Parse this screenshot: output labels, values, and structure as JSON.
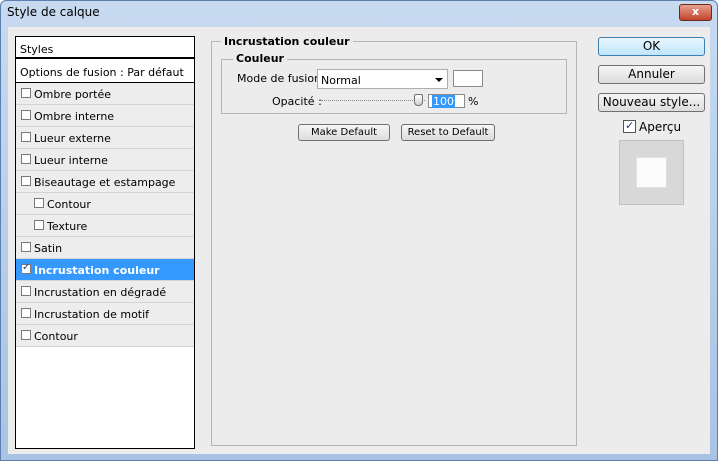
{
  "window": {
    "title": "Style de calque",
    "close_label": "x"
  },
  "styles_list": {
    "header": "Styles",
    "options": "Options de fusion : Par défaut",
    "items": [
      {
        "label": "Ombre portée",
        "checked": false,
        "indent": false,
        "selected": false
      },
      {
        "label": "Ombre interne",
        "checked": false,
        "indent": false,
        "selected": false
      },
      {
        "label": "Lueur externe",
        "checked": false,
        "indent": false,
        "selected": false
      },
      {
        "label": "Lueur interne",
        "checked": false,
        "indent": false,
        "selected": false
      },
      {
        "label": "Biseautage et estampage",
        "checked": false,
        "indent": false,
        "selected": false
      },
      {
        "label": "Contour",
        "checked": false,
        "indent": true,
        "selected": false
      },
      {
        "label": "Texture",
        "checked": false,
        "indent": true,
        "selected": false
      },
      {
        "label": "Satin",
        "checked": false,
        "indent": false,
        "selected": false
      },
      {
        "label": "Incrustation couleur",
        "checked": true,
        "indent": false,
        "selected": true
      },
      {
        "label": "Incrustation en dégradé",
        "checked": false,
        "indent": false,
        "selected": false
      },
      {
        "label": "Incrustation de motif",
        "checked": false,
        "indent": false,
        "selected": false
      },
      {
        "label": "Contour",
        "checked": false,
        "indent": false,
        "selected": false
      }
    ]
  },
  "panel": {
    "title": "Incrustation couleur",
    "group_title": "Couleur",
    "blend_mode_label": "Mode de fusion :",
    "blend_mode_value": "Normal",
    "overlay_color": "#ffffff",
    "opacity_label": "Opacité :",
    "opacity_value": "100",
    "opacity_unit": "%",
    "make_default": "Make Default",
    "reset_default": "Reset to Default"
  },
  "buttons": {
    "ok": "OK",
    "cancel": "Annuler",
    "new_style": "Nouveau style...",
    "preview_label": "Aperçu"
  },
  "colors": {
    "selection": "#3399ff",
    "title_gradient_top": "#c7daf0"
  }
}
